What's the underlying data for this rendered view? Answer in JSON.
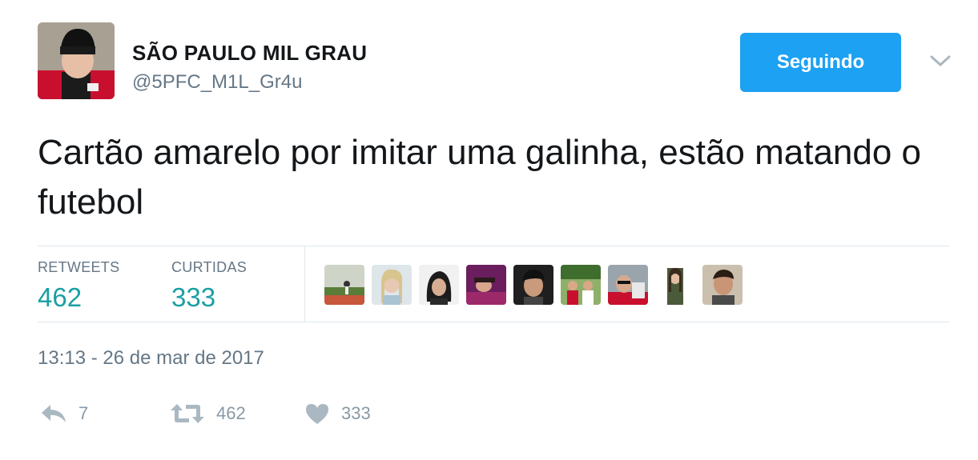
{
  "author": {
    "display_name": "SÃO PAULO MIL GRAU",
    "handle": "@5PFC_M1L_Gr4u"
  },
  "follow_button_label": "Seguindo",
  "tweet": {
    "text": "Cartão amarelo por imitar uma galinha, estão matando o futebol"
  },
  "stats": {
    "retweets_label": "RETWEETS",
    "retweets_value": "462",
    "likes_label": "CURTIDAS",
    "likes_value": "333"
  },
  "timestamp": "13:13 - 26 de mar de 2017",
  "actions": {
    "reply_count": "7",
    "retweet_count": "462",
    "like_count": "333"
  },
  "icons": {
    "more": "chevron-down-icon",
    "reply": "reply-icon",
    "retweet": "retweet-icon",
    "like": "heart-icon"
  },
  "colors": {
    "accent": "#1da1f2",
    "stat_value": "#1a9fa3",
    "muted_text": "#657786",
    "action_icon": "#aab8c2"
  }
}
